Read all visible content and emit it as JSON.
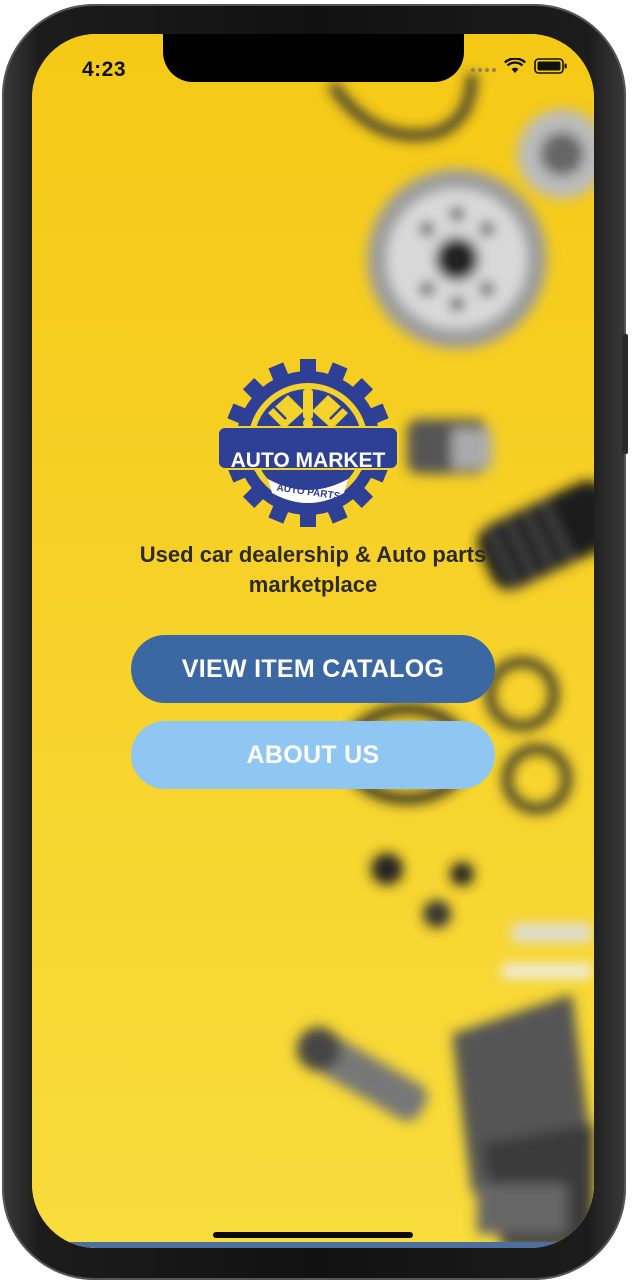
{
  "status_bar": {
    "time": "4:23"
  },
  "logo": {
    "title": "AUTO MARKET",
    "subtitle": "AUTO PARTS",
    "icon": "gear-logo-icon"
  },
  "tagline": "Used car dealership & Auto parts marketplace",
  "buttons": {
    "catalog_label": "VIEW ITEM CATALOG",
    "about_label": "ABOUT US"
  },
  "colors": {
    "background": "#f6cf1c",
    "catalog_button": "#3b67a3",
    "about_button": "#8fc7f2",
    "logo_blue": "#2e3f96"
  }
}
